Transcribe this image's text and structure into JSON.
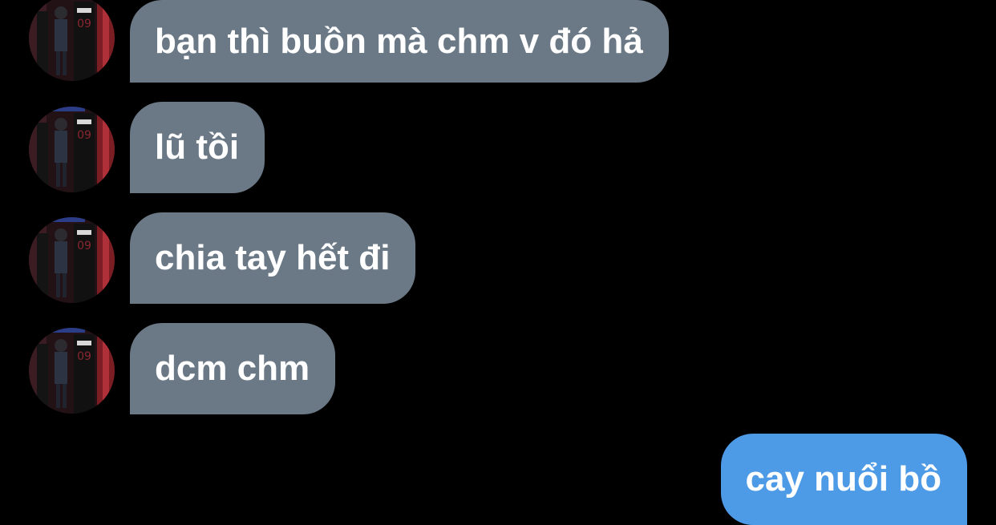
{
  "conversation": {
    "messages": [
      {
        "direction": "incoming",
        "text": "bạn thì buồn mà chm v đó hả"
      },
      {
        "direction": "incoming",
        "text": "lũ tồi"
      },
      {
        "direction": "incoming",
        "text": "chia tay hết đi"
      },
      {
        "direction": "incoming",
        "text": "dcm chm"
      },
      {
        "direction": "outgoing",
        "text": "cay nuổi bồ"
      }
    ]
  },
  "colors": {
    "background": "#000000",
    "incoming_bubble": "#6b7986",
    "outgoing_bubble": "#4d9ae6",
    "bubble_text": "#ffffff"
  },
  "icons": {
    "avatar": "contact-avatar-photo"
  }
}
